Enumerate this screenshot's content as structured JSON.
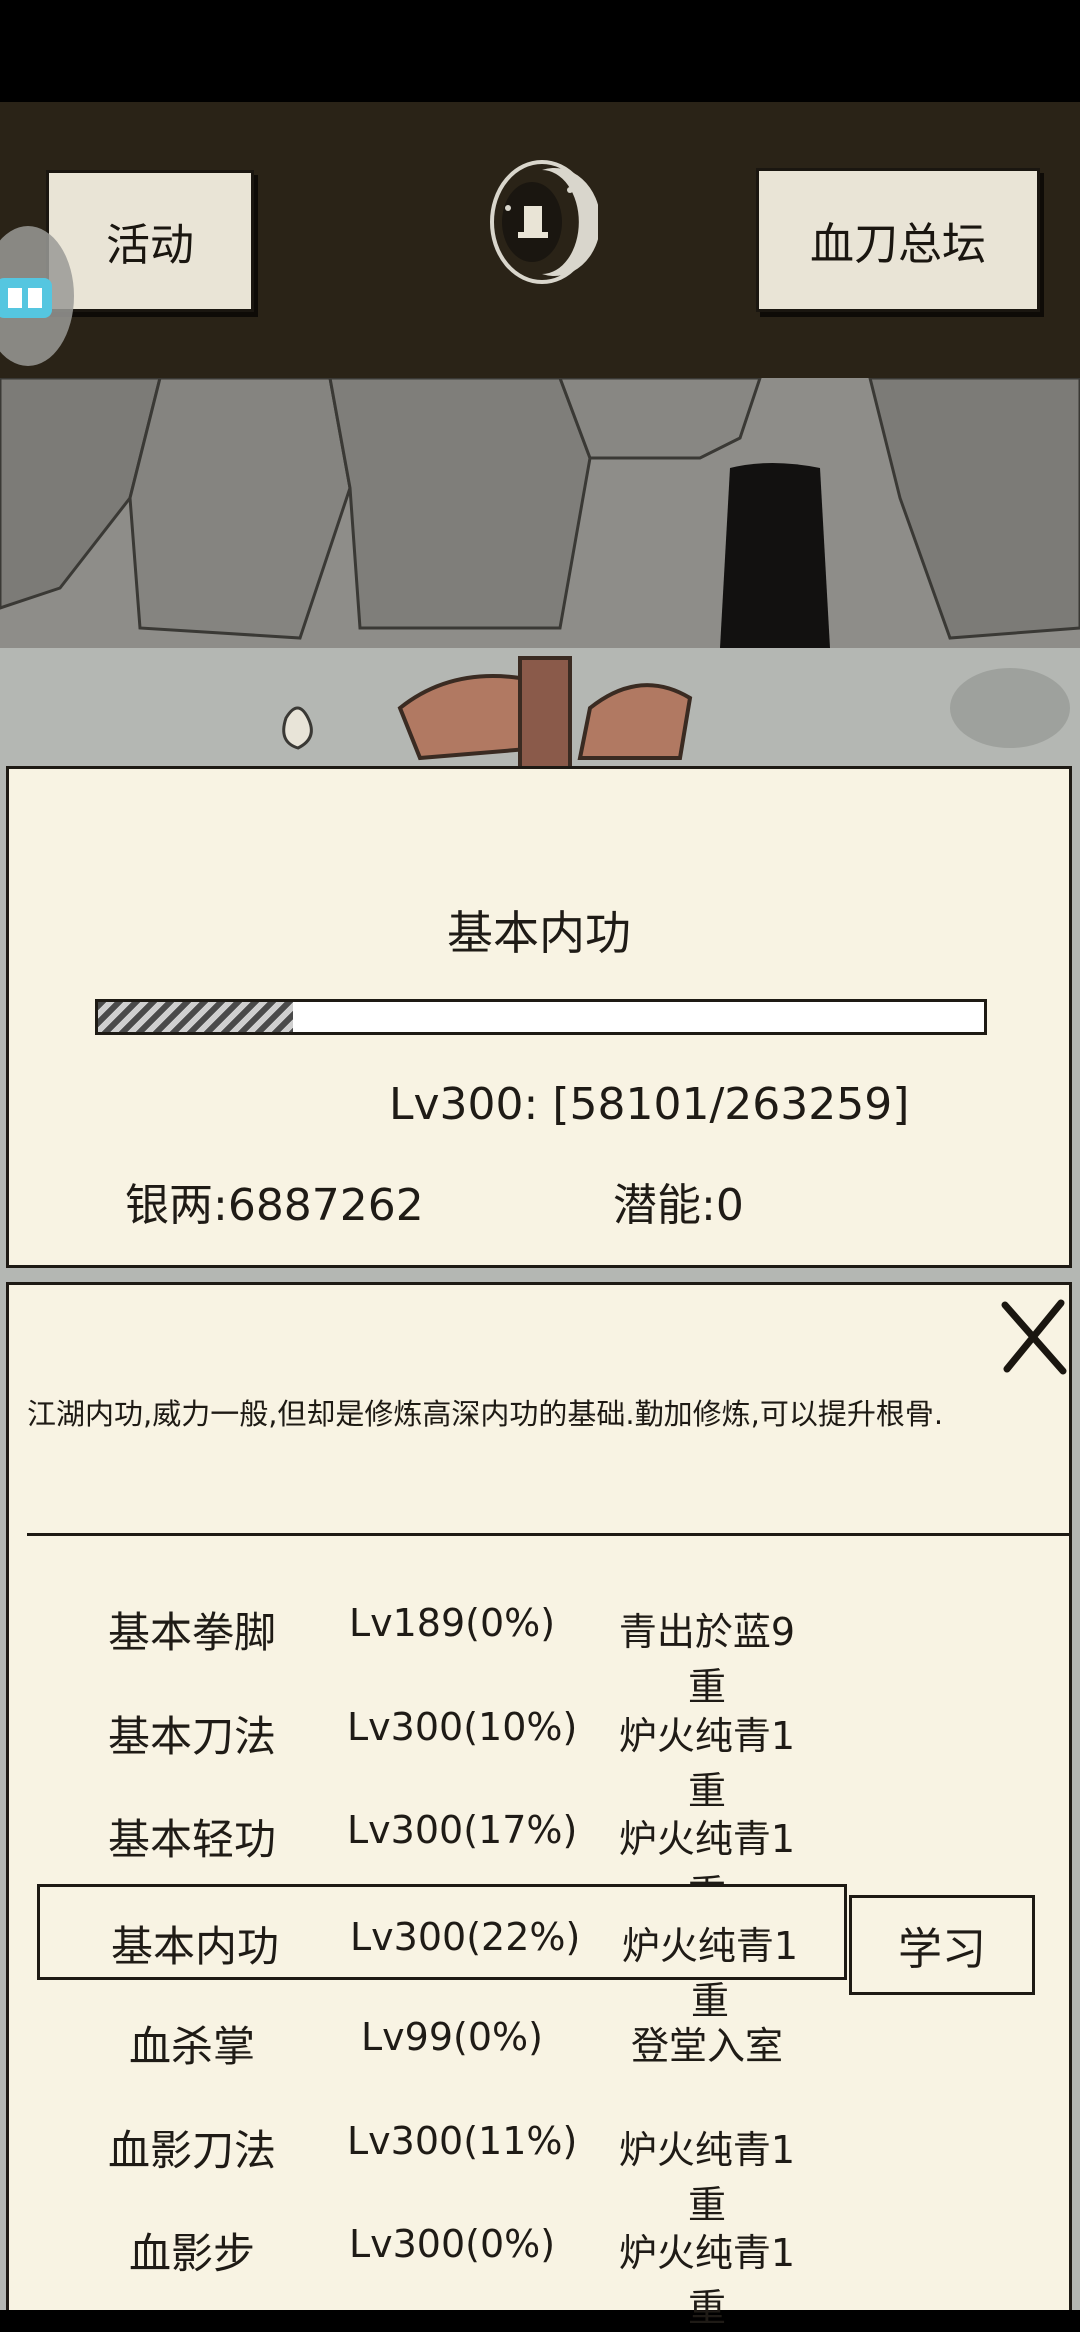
{
  "header": {
    "left_button": "活动",
    "right_button": "血刀总坛"
  },
  "skill_panel": {
    "title": "基本内功",
    "progress_fraction": 0.22,
    "level_text": "Lv300: [58101/263259]",
    "silver_text": "银两:6887262",
    "potential_text": "潜能:0"
  },
  "detail_panel": {
    "description": "江湖内功,威力一般,但却是修炼高深内功的基础.勤加修炼,可以提升根骨.",
    "learn_button": "学习",
    "skills": [
      {
        "name": "基本拳脚",
        "level": "Lv189(0%)",
        "grade": "青出於蓝9重"
      },
      {
        "name": "基本刀法",
        "level": "Lv300(10%)",
        "grade": "炉火纯青1重"
      },
      {
        "name": "基本轻功",
        "level": "Lv300(17%)",
        "grade": "炉火纯青1重"
      },
      {
        "name": "基本内功",
        "level": "Lv300(22%)",
        "grade": "炉火纯青1重"
      },
      {
        "name": "血杀掌",
        "level": "Lv99(0%)",
        "grade": "登堂入室"
      },
      {
        "name": "血影刀法",
        "level": "Lv300(11%)",
        "grade": "炉火纯青1重"
      },
      {
        "name": "血影步",
        "level": "Lv300(0%)",
        "grade": "炉火纯青1重"
      }
    ],
    "selected_index": 3
  },
  "icons": {
    "moon": "moon-emblem-icon",
    "close": "close-icon",
    "floating": "floating-assistant-icon"
  }
}
